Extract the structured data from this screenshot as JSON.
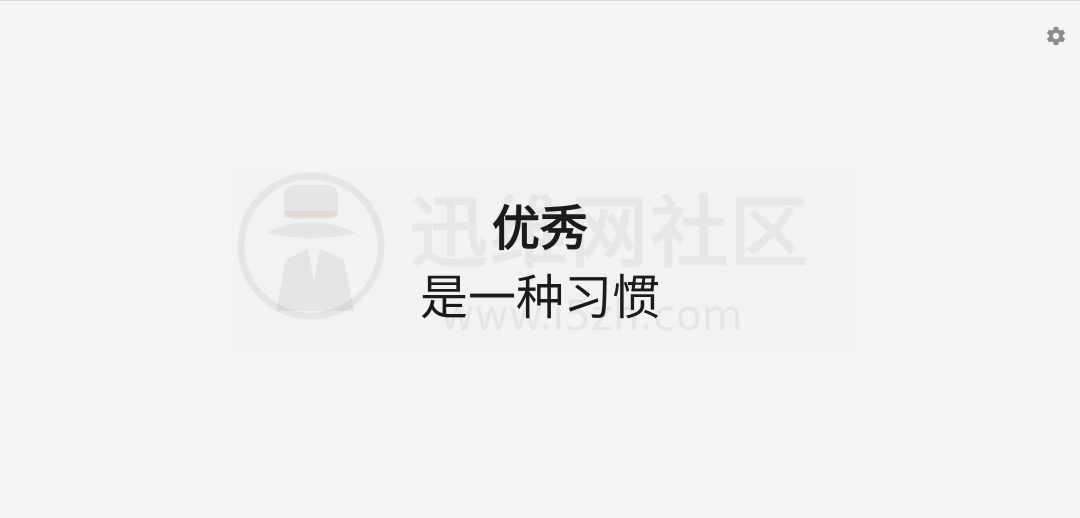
{
  "toolbar": {
    "settings_icon": "gear-icon",
    "settings_color": "#8a8a8a"
  },
  "quote": {
    "line1": "优秀",
    "line2": "是一种习惯"
  },
  "watermark": {
    "logo_icon": "hat-spy-logo",
    "title": "迅维网社区",
    "url": "www.i5zh.com"
  },
  "colors": {
    "background": "#f4f4f4",
    "text": "#1b1b1b"
  }
}
